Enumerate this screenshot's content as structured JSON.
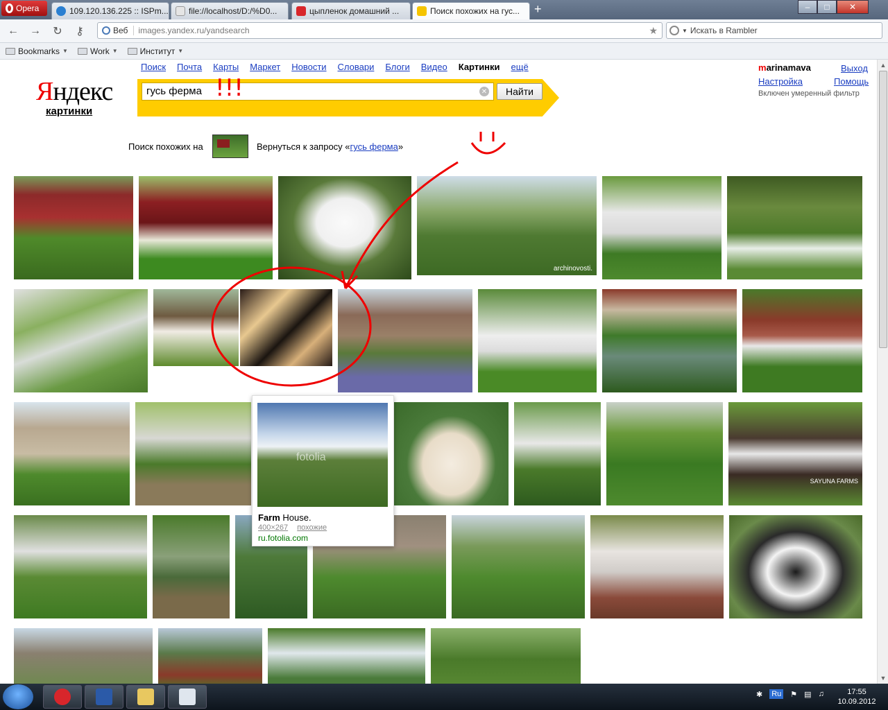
{
  "browser": {
    "opera_label": "Opera",
    "tabs": [
      {
        "label": "109.120.136.225 :: ISPm...",
        "fav": "#2a7fd1"
      },
      {
        "label": "file://localhost/D:/%D0...",
        "fav": "#e5e5e5"
      },
      {
        "label": "цыпленок домашний ...",
        "fav": "#d8262b"
      },
      {
        "label": "Поиск похожих на гус...",
        "fav": "#f5c400"
      }
    ],
    "new_tab": "+",
    "address": {
      "mode": "Веб",
      "url": "images.yandex.ru/yandsearch"
    },
    "search_placeholder": "Искать в Rambler",
    "bookmarks": [
      "Bookmarks",
      "Work",
      "Институт"
    ]
  },
  "header": {
    "logo_red": "Я",
    "logo_rest": "ндекс",
    "logo_sub": "картинки",
    "services": [
      "Поиск",
      "Почта",
      "Карты",
      "Маркет",
      "Новости",
      "Словари",
      "Блоги",
      "Видео",
      "Картинки",
      "ещё"
    ],
    "current_service": "Картинки",
    "query": "гусь ферма",
    "find_label": "Найти",
    "user_first": "m",
    "user_rest": "arinamava",
    "logout": "Выход",
    "settings": "Настройка",
    "help": "Помощь",
    "filter_note": "Включен умеренный фильтр"
  },
  "similar": {
    "label": "Поиск похожих на",
    "back_prefix": "Вернуться к запросу «",
    "back_link": "гусь ферма",
    "back_suffix": "»"
  },
  "popup": {
    "title_bold": "Farm",
    "title_rest": " House.",
    "size": "400×267",
    "similar": "похожие",
    "host": "ru.fotolia.com",
    "watermark": "fotolia"
  },
  "watermarks": {
    "archi": "archinovosti.",
    "sayuna": "SAYUNA FARMS"
  },
  "annotation": {
    "exclaim": "!!!"
  },
  "taskbar": {
    "lang": "Ru",
    "time": "17:55",
    "date": "10.09.2012"
  }
}
